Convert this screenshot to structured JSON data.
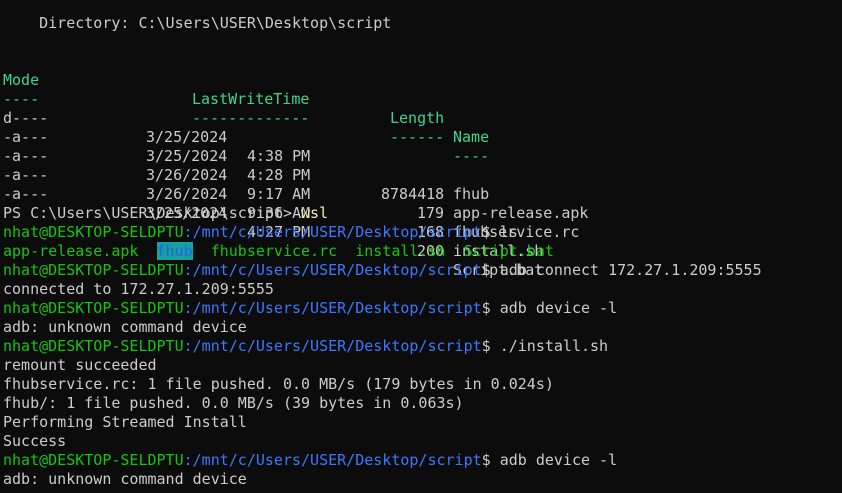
{
  "directory_line": "    Directory: C:\\Users\\USER\\Desktop\\script",
  "headers": {
    "mode": "Mode",
    "lastwritetime": "LastWriteTime",
    "length": "Length",
    "name": "Name",
    "mode_ul": "----",
    "lwt_ul": "-------------",
    "length_ul": "------",
    "name_ul": "----"
  },
  "rows": [
    {
      "mode": "d----",
      "date": "3/25/2024",
      "time": "4:38 PM",
      "length": "",
      "name": "fhub"
    },
    {
      "mode": "-a---",
      "date": "3/25/2024",
      "time": "4:28 PM",
      "length": "8784418",
      "name": "app-release.apk"
    },
    {
      "mode": "-a---",
      "date": "3/26/2024",
      "time": "9:17 AM",
      "length": "179",
      "name": "fhubservice.rc"
    },
    {
      "mode": "-a---",
      "date": "3/26/2024",
      "time": "9:36 AM",
      "length": "168",
      "name": "install.sh"
    },
    {
      "mode": "-a---",
      "date": "3/25/2024",
      "time": "4:27 PM",
      "length": "200",
      "name": "Script.bat"
    }
  ],
  "ps_prompt": "PS C:\\Users\\USER\\Desktop\\script> ",
  "ps_cmd": "wsl",
  "user": "nhat@DESKTOP-SELDPTU",
  "cwd": ":/mnt/c/Users/USER/Desktop/script",
  "dollar": "$ ",
  "cmds": {
    "c1": "ls",
    "c2": "adb connect 172.27.1.209:5555",
    "c3": "adb device -l",
    "c4": "./install.sh",
    "c5": "adb device -l"
  },
  "ls_items": {
    "a": "app-release.apk",
    "b": "fhub",
    "c": "fhubservice.rc",
    "d": "install.sh",
    "e": "Script.bat"
  },
  "outputs": {
    "o1": "connected to 172.27.1.209:5555",
    "o2": "adb: unknown command device",
    "o3": "remount succeeded",
    "o4": "fhubservice.rc: 1 file pushed. 0.0 MB/s (179 bytes in 0.024s)",
    "o5": "fhub/: 1 file pushed. 0.0 MB/s (39 bytes in 0.063s)",
    "o6": "Performing Streamed Install",
    "o7": "Success",
    "o8": "adb: unknown command device"
  },
  "colors": {
    "background": "#0c0c0c",
    "foreground": "#cccccc",
    "header": "#3dd68c",
    "prompt_user": "#16c60c",
    "prompt_path": "#3b78ff",
    "command_highlight": "#f9f1a5"
  }
}
